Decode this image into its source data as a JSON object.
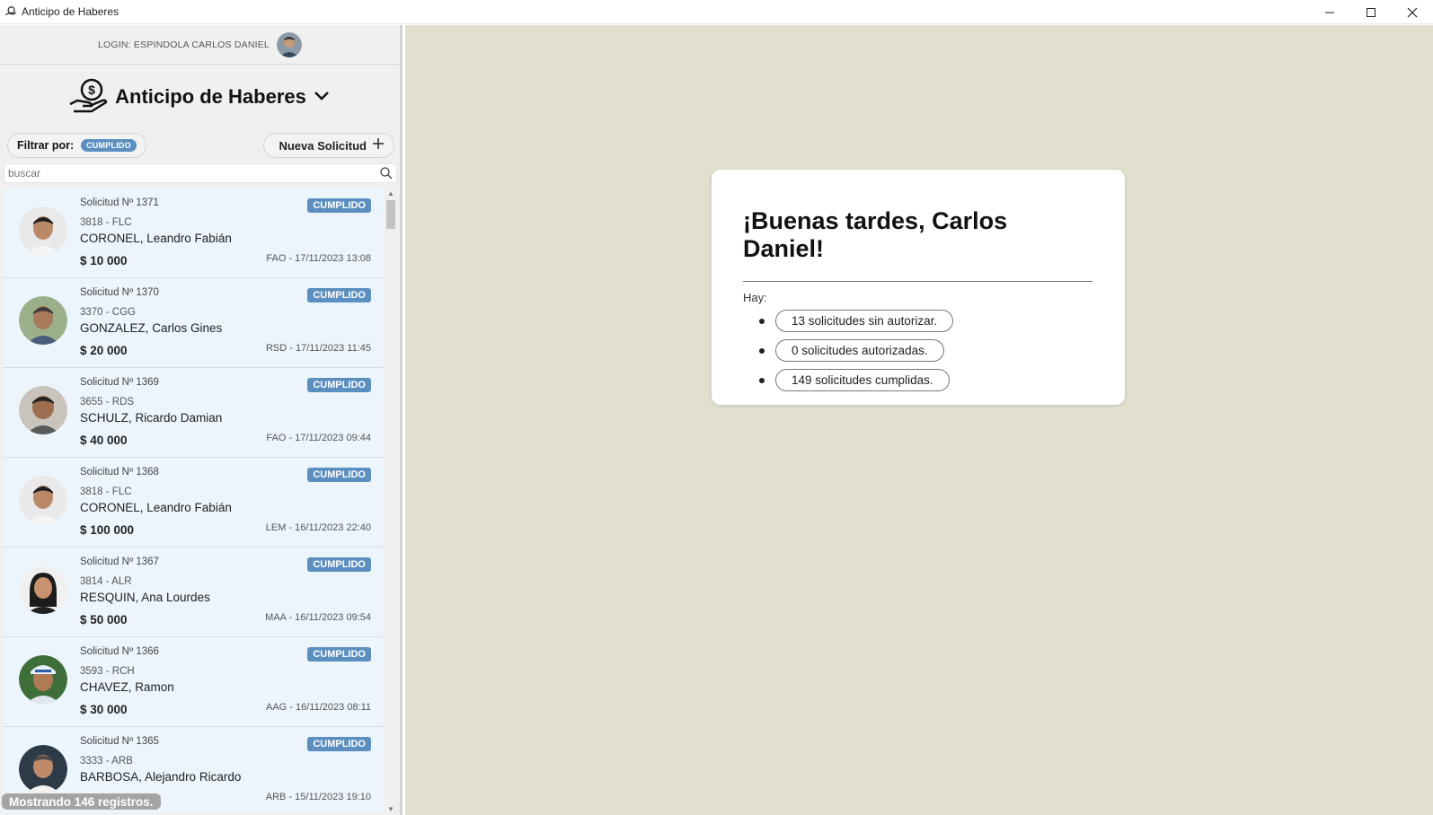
{
  "window": {
    "title": "Anticipo de Haberes",
    "icon": "money-hand-icon",
    "controls": [
      "minimize-icon",
      "maximize-icon",
      "close-icon"
    ]
  },
  "sidebar": {
    "login_label": "LOGIN:  ESPINDOLA CARLOS DANIEL",
    "app_title": "Anticipo de Haberes",
    "filter": {
      "label": "Filtrar por:",
      "value": "CUMPLIDO"
    },
    "new_request_label": "Nueva Solicitud",
    "search_placeholder": "buscar",
    "footer": "Mostrando 146 registros.",
    "items": [
      {
        "number": "Solicitud Nº 1371",
        "code": "3818 - FLC",
        "name": "CORONEL, Leandro Fabián",
        "amount": "$ 10 000",
        "status": "CUMPLIDO",
        "meta": "FAO - 17/11/2023 13:08"
      },
      {
        "number": "Solicitud Nº 1370",
        "code": "3370 - CGG",
        "name": "GONZALEZ, Carlos Gines",
        "amount": "$ 20 000",
        "status": "CUMPLIDO",
        "meta": "RSD - 17/11/2023 11:45"
      },
      {
        "number": "Solicitud Nº 1369",
        "code": "3655 - RDS",
        "name": "SCHULZ, Ricardo Damian",
        "amount": "$ 40 000",
        "status": "CUMPLIDO",
        "meta": "FAO - 17/11/2023 09:44"
      },
      {
        "number": "Solicitud Nº 1368",
        "code": "3818 - FLC",
        "name": "CORONEL, Leandro Fabián",
        "amount": "$ 100 000",
        "status": "CUMPLIDO",
        "meta": "LEM - 16/11/2023 22:40"
      },
      {
        "number": "Solicitud Nº 1367",
        "code": "3814 - ALR",
        "name": "RESQUIN, Ana Lourdes",
        "amount": "$ 50 000",
        "status": "CUMPLIDO",
        "meta": "MAA - 16/11/2023 09:54"
      },
      {
        "number": "Solicitud Nº 1366",
        "code": "3593 - RCH",
        "name": "CHAVEZ, Ramon",
        "amount": "$ 30 000",
        "status": "CUMPLIDO",
        "meta": "AAG - 16/11/2023 08:11"
      },
      {
        "number": "Solicitud Nº 1365",
        "code": "3333 - ARB",
        "name": "BARBOSA, Alejandro Ricardo",
        "amount": "",
        "status": "CUMPLIDO",
        "meta": "ARB - 15/11/2023 19:10"
      }
    ]
  },
  "main": {
    "greeting": "¡Buenas tardes, Carlos Daniel!",
    "hay_label": "Hay:",
    "stats": [
      "13 solicitudes sin autorizar.",
      "0 solicitudes autorizadas.",
      "149 solicitudes cumplidas."
    ]
  },
  "colors": {
    "accent_badge": "#5b8fbf",
    "main_background": "#e2dfcf",
    "list_item_background": "#ecf5fc"
  }
}
